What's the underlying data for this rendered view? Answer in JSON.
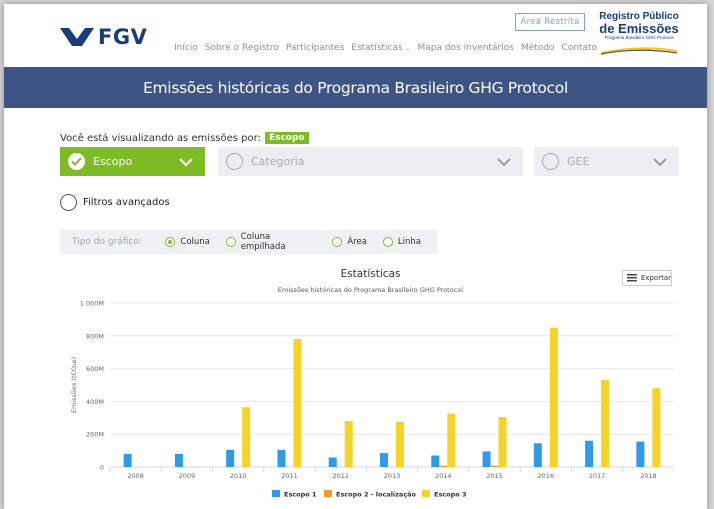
{
  "header": {
    "logo_text": "FGV",
    "nav": [
      "Início",
      "Sobre o Registro",
      "Participantes",
      "Estatísticas",
      "Mapa dos inventários",
      "Método",
      "Contato"
    ],
    "area_restrita": "Área Restrita",
    "registro_line1": "Registro Público",
    "registro_line2": "de Emissões",
    "registro_line3": "Programa Brasileiro GHG Protocol"
  },
  "banner": {
    "title": "Emissões históricas do Programa Brasileiro GHG Protocol"
  },
  "filters": {
    "viewing_label": "Você está visualizando as emissões por:",
    "viewing_tag": "Escopo",
    "escopo": "Escopo",
    "categoria": "Categoria",
    "gee": "GEE",
    "advanced": "Filtros avançados"
  },
  "chart_type": {
    "label": "Tipo do gráfico:",
    "options": [
      "Coluna",
      "Coluna empilhada",
      "Área",
      "Linha"
    ],
    "selected": "Coluna"
  },
  "export_label": "Exportar",
  "colors": {
    "green": "#7ebc26",
    "navy": "#3d5485",
    "escopo1": "#2f9be8",
    "escopo2": "#f0a020",
    "escopo3": "#f5d327"
  },
  "chart_data": {
    "type": "bar",
    "title": "Estatísticas",
    "subtitle": "Emissões históricas do Programa Brasileiro GHG Protocol",
    "ylabel": "Emissões (tCO₂e)",
    "xlabel": "",
    "ylim": [
      0,
      1000000000
    ],
    "yticks": [
      0,
      200000000,
      400000000,
      600000000,
      800000000,
      1000000000
    ],
    "ytick_labels": [
      "0",
      "200M",
      "400M",
      "600M",
      "800M",
      "1.000M"
    ],
    "categories": [
      "2008",
      "2009",
      "2010",
      "2011",
      "2012",
      "2013",
      "2014",
      "2015",
      "2016",
      "2017",
      "2018"
    ],
    "series": [
      {
        "name": "Escopo 1",
        "values": [
          80000000,
          80000000,
          105000000,
          105000000,
          58000000,
          85000000,
          70000000,
          95000000,
          145000000,
          160000000,
          155000000
        ]
      },
      {
        "name": "Escopo 2 - localização",
        "values": [
          0,
          0,
          0,
          0,
          0,
          0,
          8000000,
          8000000,
          0,
          0,
          0
        ]
      },
      {
        "name": "Escopo 3",
        "values": [
          0,
          0,
          365000000,
          780000000,
          280000000,
          275000000,
          325000000,
          305000000,
          850000000,
          530000000,
          480000000
        ]
      }
    ],
    "legend_position": "bottom",
    "grid": true
  }
}
